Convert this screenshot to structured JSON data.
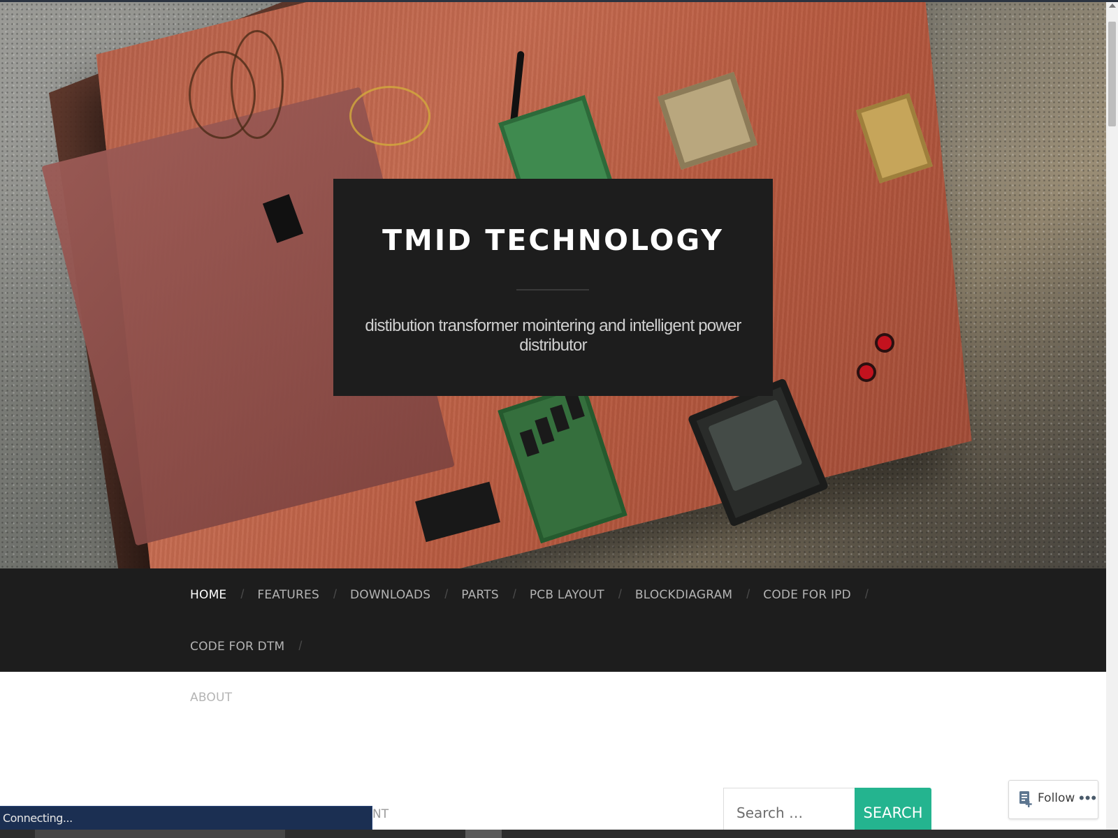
{
  "header": {
    "site_title": "TMID TECHNOLOGY",
    "tagline": "distibution transformer mointering and intelligent power distributor"
  },
  "nav": {
    "items": [
      {
        "label": "HOME",
        "active": true
      },
      {
        "label": "FEATURES"
      },
      {
        "label": "DOWNLOADS"
      },
      {
        "label": "PARTS"
      },
      {
        "label": "PCB LAYOUT"
      },
      {
        "label": "BLOCKDIAGRAM"
      },
      {
        "label": "CODE FOR IPD"
      },
      {
        "label": "CODE FOR DTM"
      },
      {
        "label": "ABOUT"
      }
    ],
    "separator": "/"
  },
  "content": {
    "partial_text": "NT"
  },
  "search": {
    "placeholder": "Search …",
    "button_label": "SEARCH"
  },
  "follow": {
    "label": "Follow",
    "more": "•••",
    "icon": "reader-follow-icon"
  },
  "status": {
    "text": "Connecting..."
  },
  "colors": {
    "nav_background": "#1d1d1d",
    "search_button": "#24b48f",
    "status_bar": "#1b2f52"
  }
}
